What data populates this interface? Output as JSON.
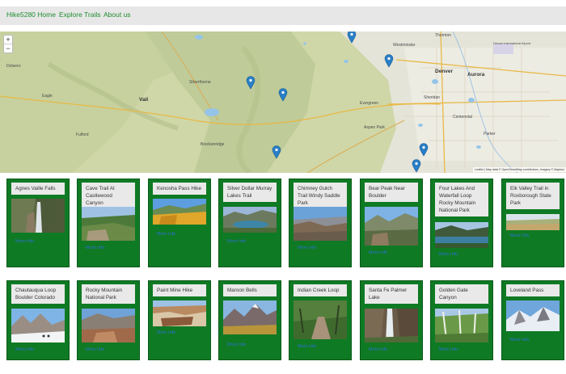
{
  "nav": {
    "links": [
      "Hike5280 Home",
      "Explore Trails",
      "About us"
    ]
  },
  "map": {
    "zoom_in": "+",
    "zoom_out": "−",
    "attribution": "Leaflet | Map data © OpenStreetMap contributors, Imagery © Mapbox",
    "labels": [
      "Thornton",
      "Westminster",
      "Denver",
      "Aurora",
      "Sheridan",
      "Centennial",
      "Parker",
      "Silverthorne",
      "Evergreen",
      "Breckenridge",
      "Vail",
      "Dotsero",
      "Eagle",
      "Aspen Park",
      "Fulford",
      "Denver International Airport"
    ],
    "pin_color": "#2a7fc6"
  },
  "trails": [
    {
      "title": "Agnes Vaille Falls",
      "link": "More Info"
    },
    {
      "title": "Cave Trail At Castlewood Canyon",
      "link": "More Info"
    },
    {
      "title": "Kenosha Pass Hike",
      "link": "More Info"
    },
    {
      "title": "Silver Dollar Murray Lakes Trail",
      "link": "More Info"
    },
    {
      "title": "Chimney Gulch Trail Windy Saddle Park",
      "link": "More Info"
    },
    {
      "title": "Bear Peak Near Boulder",
      "link": "More Info"
    },
    {
      "title": "Four Lakes And Waterfall Loop Rocky Mountain National Park",
      "link": "More Info"
    },
    {
      "title": "Elk Valley Trail in Roxborough State Park",
      "link": "More Info"
    },
    {
      "title": "Chautauqua Loop Boulder Colorado",
      "link": "More Info"
    },
    {
      "title": "Rocky Mountain National Park",
      "link": "More Info"
    },
    {
      "title": "Paint Mine Hike",
      "link": "More Info"
    },
    {
      "title": "Maroon Bells",
      "link": "More Info"
    },
    {
      "title": "Indian Creek Loop",
      "link": "More Info"
    },
    {
      "title": "Santa Fe Palmer Lake",
      "link": "More Info"
    },
    {
      "title": "Golden Gate Canyon",
      "link": "More Info"
    },
    {
      "title": "Loveland Pass",
      "link": "More Info"
    }
  ],
  "colors": {
    "card_green": "#0f7a24",
    "nav_link": "#1e8e2f",
    "more_info_link": "#2a6fd6"
  }
}
